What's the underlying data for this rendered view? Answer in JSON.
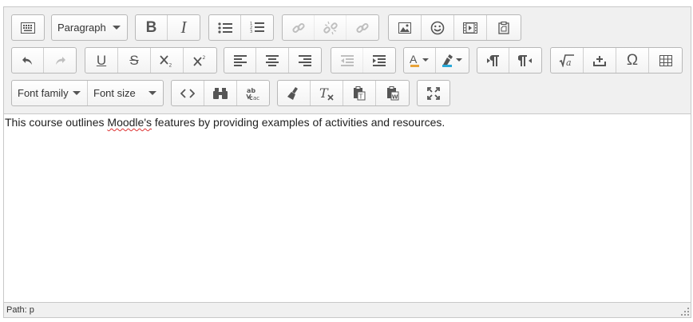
{
  "toolbar": {
    "block_format": "Paragraph",
    "font_family": "Font family",
    "font_size": "Font size",
    "bold_glyph": "B",
    "italic_glyph": "I",
    "underline_glyph": "U",
    "strike_glyph": "S",
    "omega_glyph": "Ω"
  },
  "content": {
    "text_before": "This course outlines ",
    "misspelled": "Moodle's",
    "text_after": " features by providing examples of activities and resources."
  },
  "statusbar": {
    "path_label": "Path: p"
  }
}
